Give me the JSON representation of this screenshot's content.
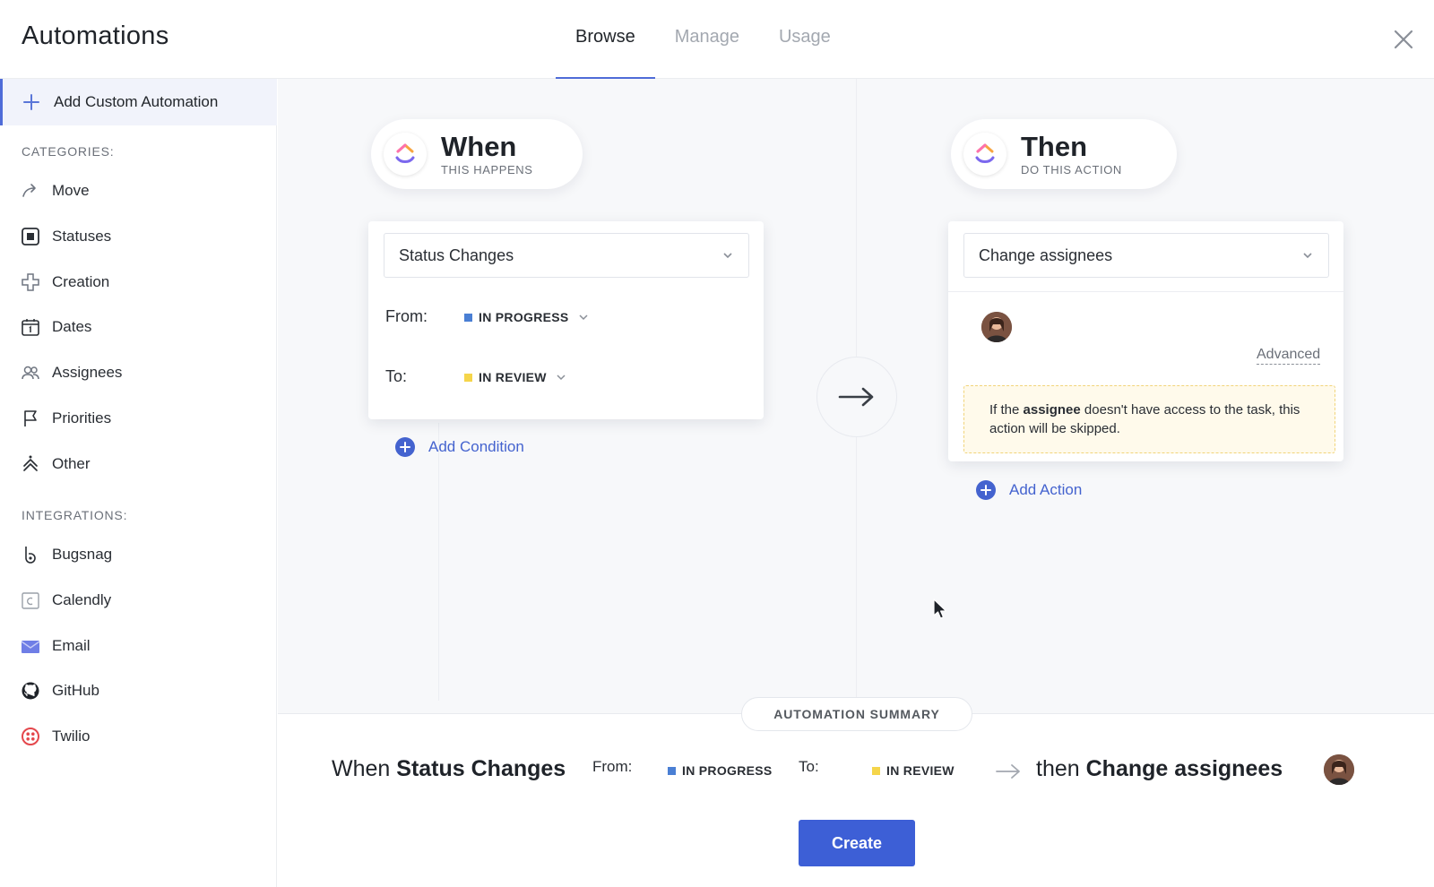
{
  "header": {
    "title": "Automations",
    "tabs": [
      {
        "label": "Browse",
        "active": true
      },
      {
        "label": "Manage",
        "active": false
      },
      {
        "label": "Usage",
        "active": false
      }
    ]
  },
  "sidebar": {
    "add_custom_label": "Add Custom Automation",
    "categories_title": "CATEGORIES:",
    "categories": [
      {
        "label": "Move",
        "icon": "move-icon"
      },
      {
        "label": "Statuses",
        "icon": "status-icon"
      },
      {
        "label": "Creation",
        "icon": "creation-icon"
      },
      {
        "label": "Dates",
        "icon": "calendar-icon"
      },
      {
        "label": "Assignees",
        "icon": "assignees-icon"
      },
      {
        "label": "Priorities",
        "icon": "flag-icon"
      },
      {
        "label": "Other",
        "icon": "other-icon"
      }
    ],
    "integrations_title": "INTEGRATIONS:",
    "integrations": [
      {
        "label": "Bugsnag",
        "icon": "bugsnag-icon"
      },
      {
        "label": "Calendly",
        "icon": "calendly-icon"
      },
      {
        "label": "Email",
        "icon": "email-icon"
      },
      {
        "label": "GitHub",
        "icon": "github-icon"
      },
      {
        "label": "Twilio",
        "icon": "twilio-icon"
      }
    ]
  },
  "when": {
    "title": "When",
    "subtitle": "THIS HAPPENS",
    "trigger": "Status Changes",
    "from_label": "From:",
    "from_status": "IN PROGRESS",
    "to_label": "To:",
    "to_status": "IN REVIEW",
    "add_condition": "Add Condition"
  },
  "then": {
    "title": "Then",
    "subtitle": "DO THIS ACTION",
    "action": "Change assignees",
    "advanced": "Advanced",
    "notice_pre": "If the ",
    "notice_bold": "assignee",
    "notice_post": " doesn't have access to the task, this action will be skipped.",
    "add_action": "Add Action"
  },
  "summary": {
    "tag": "AUTOMATION SUMMARY",
    "when_word": "When",
    "trigger": "Status Changes",
    "from_label": "From:",
    "from_status": "IN PROGRESS",
    "to_label": "To:",
    "to_status": "IN REVIEW",
    "then_word": "then",
    "action": "Change assignees"
  },
  "create_label": "Create",
  "colors": {
    "accent": "#4463cf",
    "in_progress": "#4a7fd4",
    "in_review": "#f5d54a"
  }
}
